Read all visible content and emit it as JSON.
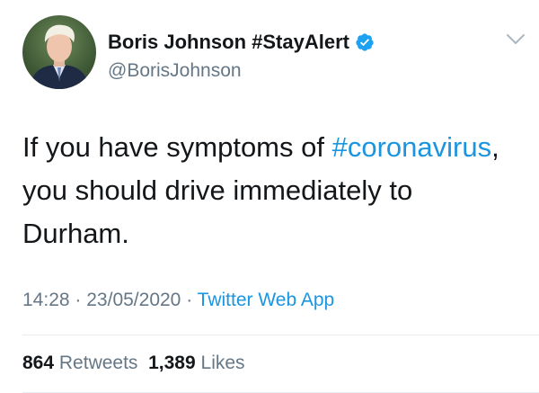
{
  "user": {
    "display_name": "Boris Johnson #StayAlert",
    "handle": "@BorisJohnson"
  },
  "tweet": {
    "text_before": "If you have symptoms of",
    "hashtag": "#coronavirus",
    "text_after": ", you should drive immediately to Durham."
  },
  "meta": {
    "time": "14:28",
    "date": "23/05/2020",
    "source": "Twitter Web App",
    "separator": "·"
  },
  "stats": {
    "retweets_count": "864",
    "retweets_label": "Retweets",
    "likes_count": "1,389",
    "likes_label": "Likes"
  },
  "colors": {
    "link": "#1b95e0",
    "muted": "#657786",
    "text": "#14171a",
    "verified": "#1da1f2"
  }
}
